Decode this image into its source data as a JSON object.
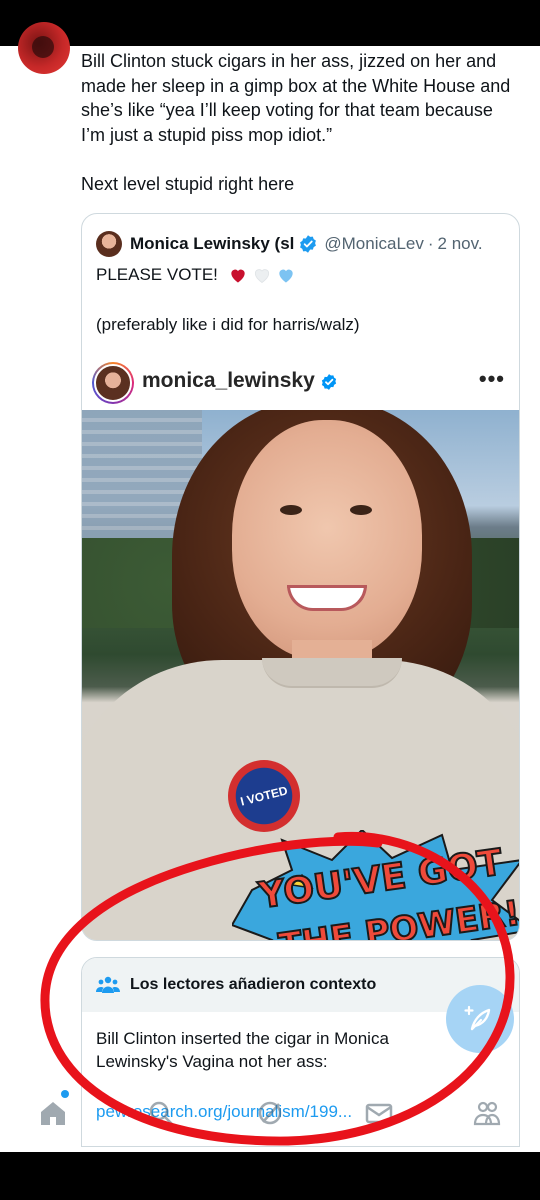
{
  "tweet": {
    "text": "Bill Clinton stuck cigars in her ass, jizzed on her and made her sleep in a gimp box at the White House and she’s like “yea I’ll keep voting for that team because I’m just a stupid piss mop idiot.”\n\nNext level stupid right here"
  },
  "quote": {
    "name": "Monica Lewinsky (sl",
    "handle": "@MonicaLev",
    "dot": "·",
    "time": "2 nov.",
    "line1": "PLEASE VOTE!",
    "line2": "(preferably like i did for harris/walz)",
    "hearts": [
      "red-heart",
      "white-heart",
      "blue-heart"
    ]
  },
  "instagram": {
    "username": "monica_lewinsky",
    "more": "•••",
    "sticker_text": "I VOTED",
    "shirt_line1": "YOU'VE GOT",
    "shirt_line2": "THE POWER!"
  },
  "context_note": {
    "title": "Los lectores añadieron contexto",
    "body": "Bill Clinton inserted the cigar in Monica Lewinsky's Vagina not her ass:",
    "link": "pewresearch.org/journalism/199..."
  },
  "nav": {
    "items": [
      "home-icon",
      "search-icon",
      "grok-icon",
      "mail-icon",
      "communities-icon"
    ]
  },
  "colors": {
    "accent": "#1d9bf0",
    "annotation": "#e8131b"
  }
}
